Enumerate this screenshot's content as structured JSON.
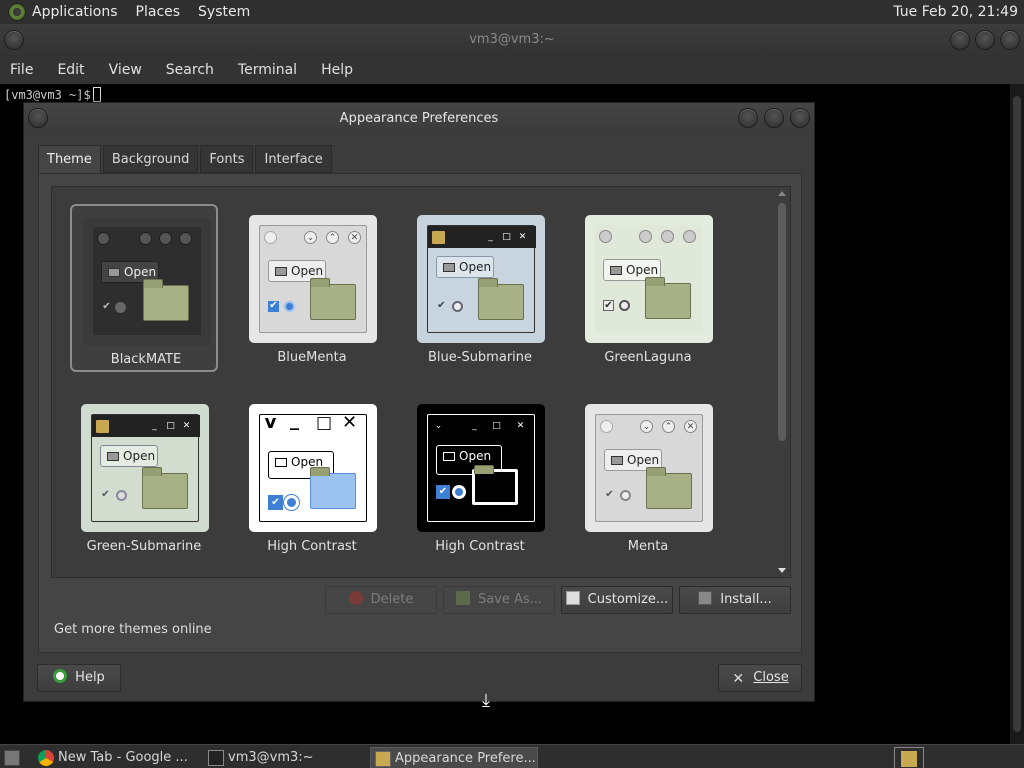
{
  "top_panel": {
    "menus": [
      "Applications",
      "Places",
      "System"
    ],
    "clock": "Tue Feb 20, 21:49"
  },
  "terminal": {
    "title": "vm3@vm3:~",
    "menus": [
      "File",
      "Edit",
      "View",
      "Search",
      "Terminal",
      "Help"
    ],
    "prompt": "[vm3@vm3 ~]$"
  },
  "dialog": {
    "title": "Appearance Preferences",
    "tabs": [
      "Theme",
      "Background",
      "Fonts",
      "Interface"
    ],
    "active_tab": "Theme",
    "themes": [
      {
        "name": "BlackMATE",
        "selected": true
      },
      {
        "name": "BlueMenta"
      },
      {
        "name": "Blue-Submarine"
      },
      {
        "name": "GreenLaguna"
      },
      {
        "name": "Green-Submarine"
      },
      {
        "name": "High Contrast"
      },
      {
        "name": "High Contrast"
      },
      {
        "name": "Menta"
      }
    ],
    "thumb_open_label": "Open",
    "buttons": {
      "delete": "Delete",
      "save_as": "Save As...",
      "customize": "Customize...",
      "install": "Install..."
    },
    "online_link": "Get more themes online",
    "help": "Help",
    "close": "Close"
  },
  "taskbar": {
    "tasks": [
      "New Tab - Google ...",
      "vm3@vm3:~",
      "Appearance Prefere..."
    ]
  },
  "colors": {
    "panel": "#2f2f2f",
    "dialog_bg": "#3c3c3c",
    "accent_blue": "#3e7fd6",
    "folder_green": "#a8b085"
  }
}
